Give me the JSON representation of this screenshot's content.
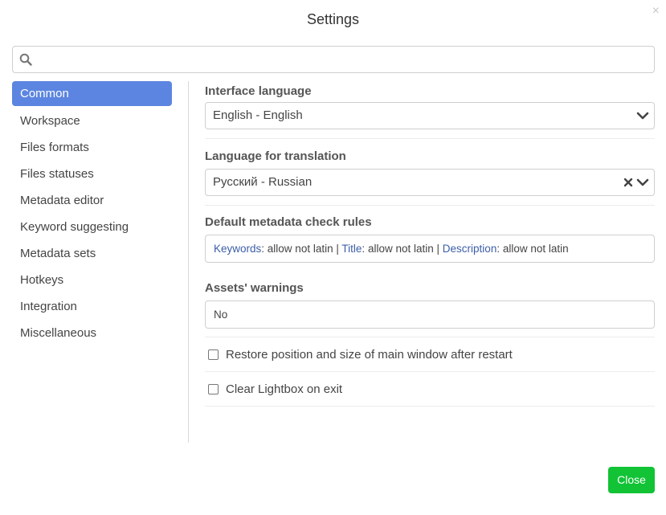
{
  "dialog": {
    "title": "Settings",
    "close_glyph": "×"
  },
  "search": {
    "value": "",
    "placeholder": "",
    "icon": "search-icon"
  },
  "sidebar": {
    "items": [
      {
        "label": "Common",
        "active": true
      },
      {
        "label": "Workspace"
      },
      {
        "label": "Files formats"
      },
      {
        "label": "Files statuses"
      },
      {
        "label": "Metadata editor"
      },
      {
        "label": "Keyword suggesting"
      },
      {
        "label": "Metadata sets"
      },
      {
        "label": "Hotkeys"
      },
      {
        "label": "Integration"
      },
      {
        "label": "Miscellaneous"
      }
    ]
  },
  "content": {
    "interface_language": {
      "label": "Interface language",
      "value": "English - English"
    },
    "translation_language": {
      "label": "Language for translation",
      "value": "Русский - Russian"
    },
    "metadata_rules": {
      "label": "Default metadata check rules",
      "rules": [
        {
          "key": "Keywords",
          "value": "allow not latin"
        },
        {
          "key": "Title",
          "value": "allow not latin"
        },
        {
          "key": "Description",
          "value": "allow not latin"
        }
      ],
      "separator": "|"
    },
    "assets_warnings": {
      "label": "Assets' warnings",
      "value": "No"
    },
    "checkboxes": [
      {
        "label": "Restore position and size of main window after restart",
        "checked": false
      },
      {
        "label": "Clear Lightbox on exit",
        "checked": false
      }
    ]
  },
  "footer": {
    "close_label": "Close"
  },
  "colors": {
    "accent": "#5b85e0",
    "close_button": "#11c335",
    "rule_key": "#3b5ea8"
  }
}
